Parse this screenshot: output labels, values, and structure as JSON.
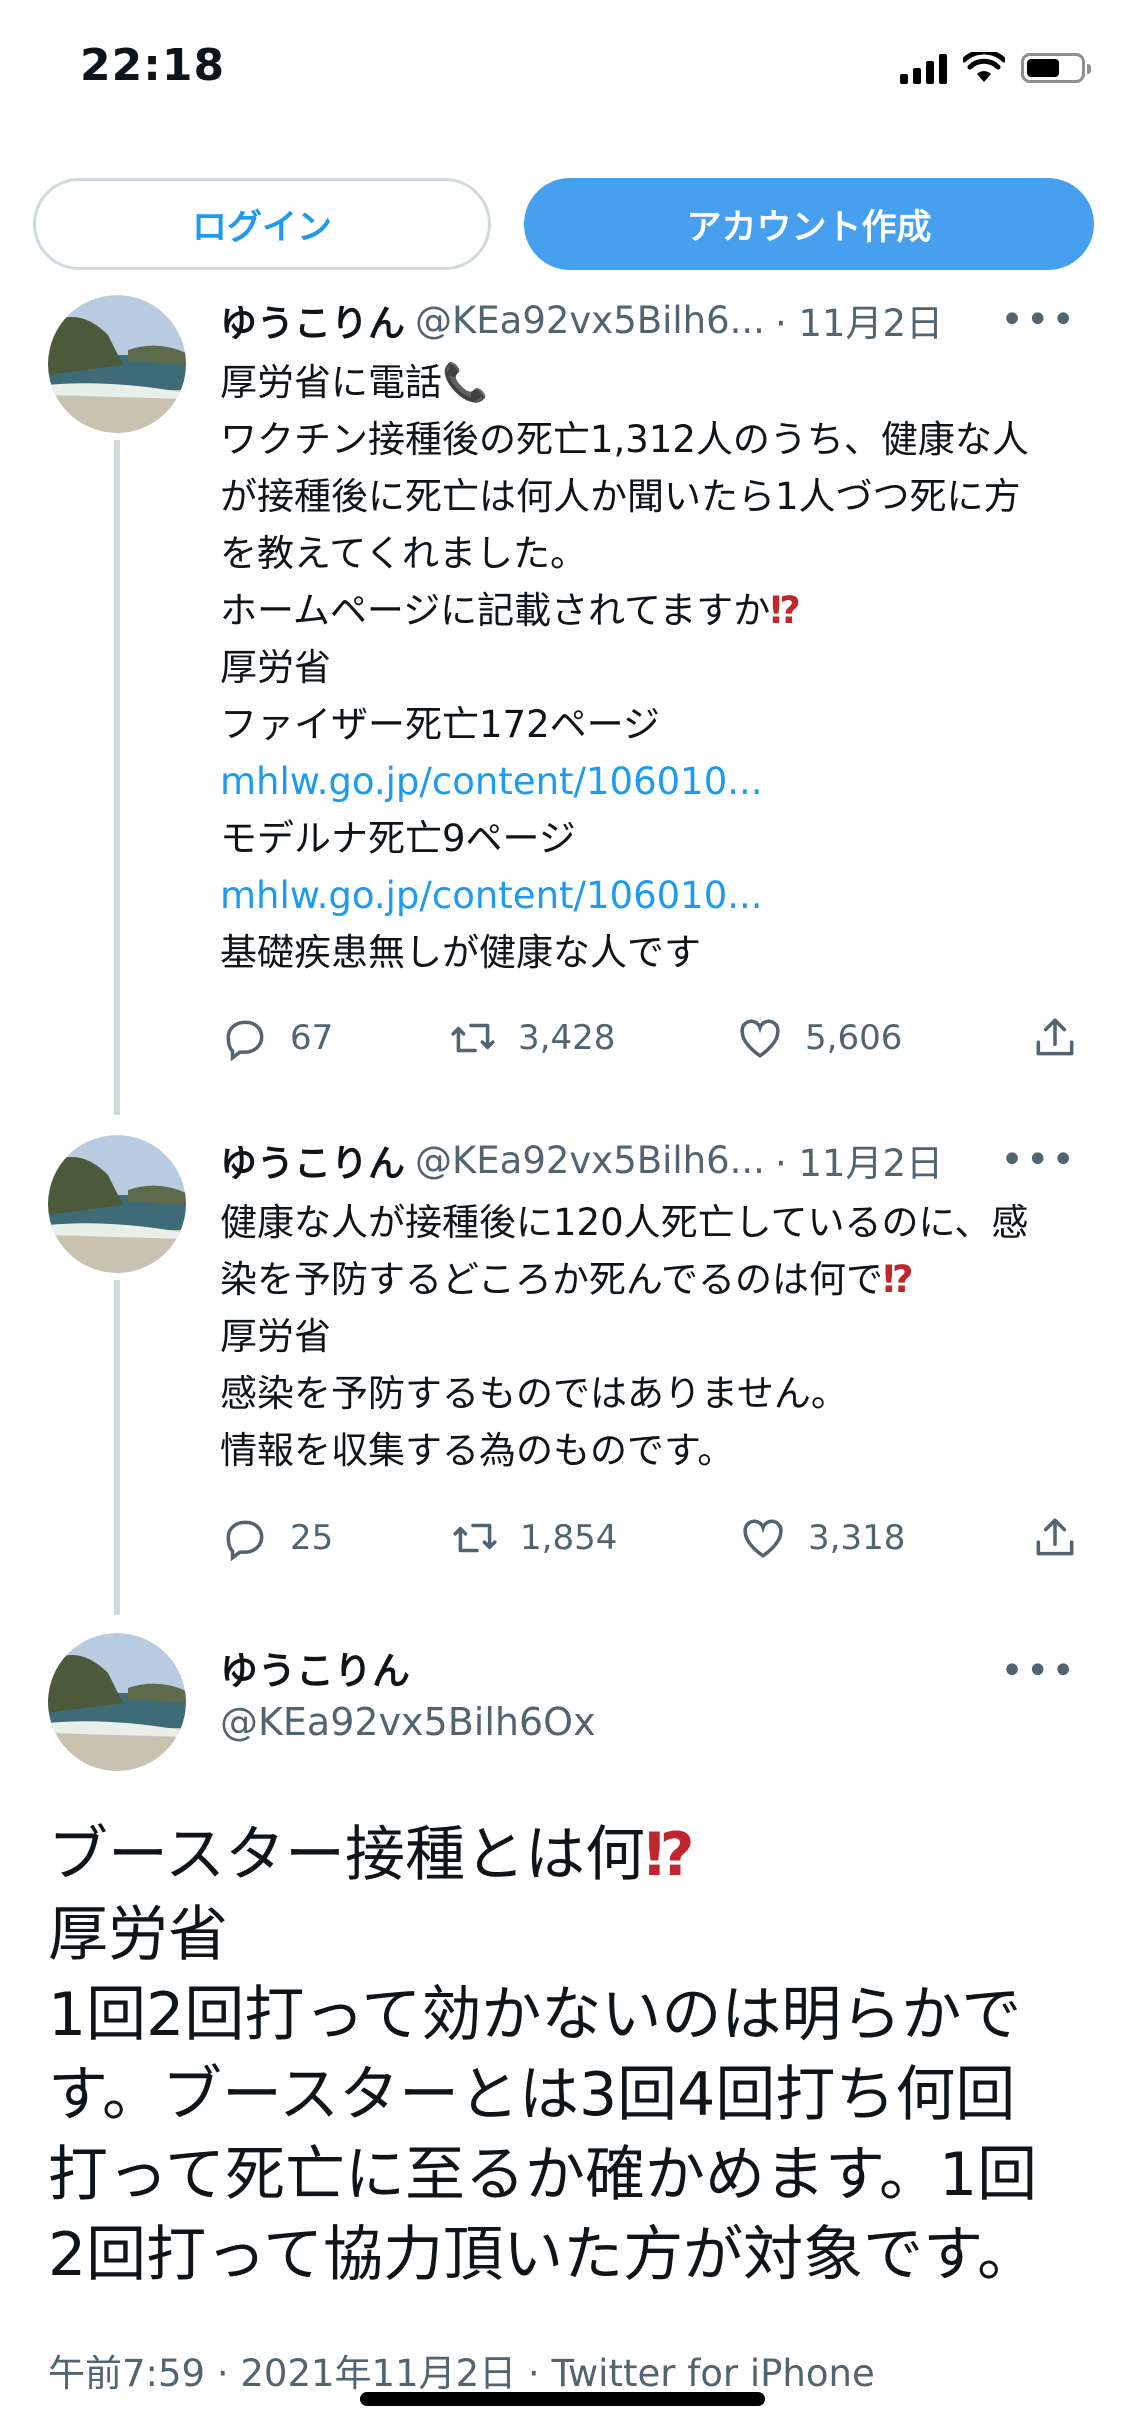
{
  "status_bar": {
    "time": "22:18"
  },
  "header": {
    "login_label": "ログイン",
    "signup_label": "アカウント作成"
  },
  "tweets": [
    {
      "name": "ゆうこりん",
      "handle": "@KEa92vx5Bilh6...",
      "date": "· 11月2日",
      "lines": [
        "厚労省に電話📞",
        "ワクチン接種後の死亡1,312人のうち、健康な人",
        "が接種後に死亡は何人か聞いたら1人づつ死に方",
        "を教えてくれました。",
        "ホームページに記載されてますか",
        "厚労省",
        "ファイザー死亡172ページ",
        "mhlw.go.jp/content/106010...",
        "モデルナ死亡9ページ",
        "mhlw.go.jp/content/106010...",
        "基礎疾患無しが健康な人です"
      ],
      "replies": "67",
      "retweets": "3,428",
      "likes": "5,606"
    },
    {
      "name": "ゆうこりん",
      "handle": "@KEa92vx5Bilh6...",
      "date": "· 11月2日",
      "lines": [
        "健康な人が接種後に120人死亡しているのに、感",
        "染を予防するどころか死んでるのは何で",
        "厚労省",
        "感染を予防するものではありません。",
        "情報を収集する為のものです。"
      ],
      "replies": "25",
      "retweets": "1,854",
      "likes": "3,318"
    }
  ],
  "main_tweet": {
    "name": "ゆうこりん",
    "handle": "@KEa92vx5Bilh6Ox",
    "lines": [
      "ブースター接種とは何",
      "厚労省",
      "1回2回打って効かないのは明らかで",
      "す。ブースターとは3回4回打ち何回",
      "打って死亡に至るか確かめます。1回",
      "2回打って協力頂いた方が対象です。"
    ],
    "timestamp": "午前7:59 · 2021年11月2日 · Twitter for iPhone"
  },
  "icons": {
    "more": "more-dots-icon",
    "reply": "reply-icon",
    "retweet": "retweet-icon",
    "like": "heart-icon",
    "share": "share-icon",
    "question": "exclamation-question-icon"
  },
  "colors": {
    "accent": "#1d9bf0",
    "signup_bg": "#46a0ef",
    "secondary_text": "#536471",
    "thread_line": "#cfd9de",
    "emoji_red": "#c0272d"
  }
}
